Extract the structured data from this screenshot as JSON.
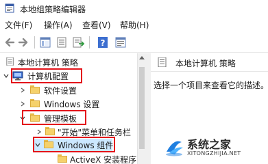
{
  "window": {
    "title": "本地组策略编辑器"
  },
  "menu": {
    "items": [
      {
        "label": "文件(F)"
      },
      {
        "label": "操作(A)"
      },
      {
        "label": "查看(V)"
      },
      {
        "label": "帮助(H)"
      }
    ]
  },
  "toolbar": {
    "buttons": [
      "back-icon",
      "forward-icon",
      "show-hide-tree-icon",
      "list-icon",
      "export-list-icon",
      "help-icon",
      "properties-view-icon"
    ]
  },
  "tree": {
    "root": "本地计算机 策略",
    "items": [
      {
        "label": "计算机配置",
        "highlighted": true
      },
      {
        "label": "软件设置"
      },
      {
        "label": "Windows 设置"
      },
      {
        "label": "管理模板",
        "highlighted": true
      },
      {
        "label": "\"开始\"菜单和任务栏"
      },
      {
        "label": "Windows 组件",
        "highlighted": true
      },
      {
        "label": "ActiveX 安装程序"
      }
    ]
  },
  "details": {
    "header": "本地计算机 策略",
    "description": "选择一个项目来查看它的描述。"
  },
  "watermark": {
    "title": "系统之家",
    "subtitle": "XITONGZHIJIA.NET"
  },
  "colors": {
    "highlight_border": "#e3141a",
    "folder": "#f5d16b",
    "selection": "#cce8ff"
  }
}
